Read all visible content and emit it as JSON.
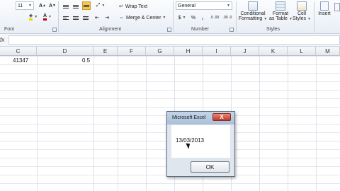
{
  "ribbon": {
    "font": {
      "size": "11",
      "group_label": "Font",
      "grow_icon": "font-grow-icon",
      "shrink_icon": "font-shrink-icon",
      "fill_icon": "fill-color-icon",
      "color_icon": "font-color-icon",
      "fill_color": "#f2d600",
      "text_color": "#c00000"
    },
    "alignment": {
      "wrap_text": "Wrap Text",
      "merge_center": "Merge & Center",
      "group_label": "Alignment"
    },
    "number": {
      "format": "General",
      "group_label": "Number",
      "currency": "$",
      "percent": "%",
      "comma": ",",
      "inc_decimal": ".0 .00",
      "dec_decimal": ".00 .0"
    },
    "styles": {
      "conditional": "Conditional",
      "conditional2": "Formatting",
      "format_table": "Format",
      "format_table2": "as Table",
      "cell_styles": "Cell",
      "cell_styles2": "Styles",
      "group_label": "Styles"
    },
    "cells": {
      "insert": "Insert"
    }
  },
  "formula_bar": {
    "fx_label": "fx",
    "value": ""
  },
  "columns": [
    "C",
    "D",
    "E",
    "F",
    "G",
    "H",
    "I",
    "J",
    "K",
    "L",
    "M"
  ],
  "cells": {
    "c1": "41347",
    "d1": "0.5"
  },
  "dialog": {
    "title": "Microsoft Excel",
    "close_label": "X",
    "message": "13/03/2013",
    "ok_label": "OK"
  }
}
